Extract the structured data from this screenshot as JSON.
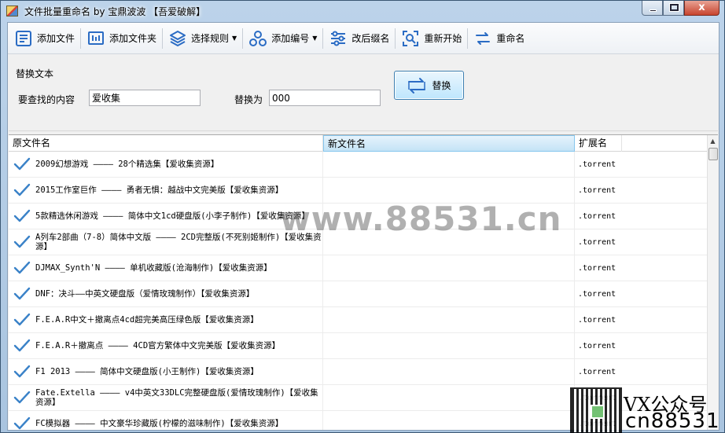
{
  "window": {
    "title": "文件批量重命名 by 宝鼎波波 【吾爱破解】",
    "close_glyph": "x"
  },
  "toolbar": {
    "add_file": "添加文件",
    "add_folder": "添加文件夹",
    "select_rule": "选择规则",
    "add_number": "添加编号",
    "change_ext": "改后缀名",
    "restart": "重新开始",
    "rename": "重命名"
  },
  "replace_panel": {
    "group_title": "替换文本",
    "find_label": "要查找的内容",
    "find_value": "爱收集",
    "replace_label": "替换为",
    "replace_value": "000",
    "replace_button": "替换"
  },
  "grid": {
    "columns": [
      "原文件名",
      "新文件名",
      "扩展名"
    ],
    "rows": [
      {
        "original": "2009幻想游戏 ———— 28个精选集【爱收集资源】",
        "new": "",
        "ext": ".torrent"
      },
      {
        "original": "2015工作室巨作 ———— 勇者无惧：越战中文完美版【爱收集资源】",
        "new": "",
        "ext": ".torrent"
      },
      {
        "original": "5款精选休闲游戏 ———— 简体中文1cd硬盘版(小李子制作)【爱收集资源】",
        "new": "",
        "ext": ".torrent"
      },
      {
        "original": "A列车2部曲（7-8）简体中文版 ———— 2CD完整版(不死别姬制作)【爱收集资源】",
        "new": "",
        "ext": ".torrent"
      },
      {
        "original": "DJMAX_Synth'N ———— 单机收藏版(沧海制作)【爱收集资源】",
        "new": "",
        "ext": ".torrent"
      },
      {
        "original": "DNF：决斗——中英文硬盘版（爱情玫瑰制作）【爱收集资源】",
        "new": "",
        "ext": ".torrent"
      },
      {
        "original": "F.E.A.R中文＋撤离点4cd超完美高压绿色版【爱收集资源】",
        "new": "",
        "ext": ".torrent"
      },
      {
        "original": "F.E.A.R＋撤离点 ———— 4CD官方繁体中文完美版【爱收集资源】",
        "new": "",
        "ext": ".torrent"
      },
      {
        "original": "F1 2013 ———— 简体中文硬盘版(小王制作)【爱收集资源】",
        "new": "",
        "ext": ".torrent"
      },
      {
        "original": "Fate.Extella ———— v4中英文33DLC完整硬盘版(爱情玫瑰制作)【爱收集资源】",
        "new": "",
        "ext": ".torrent"
      },
      {
        "original": "FC模拟器 ———— 中文豪华珍藏版(柠檬的滋味制作)【爱收集资源】",
        "new": "",
        "ext": ".torrent"
      }
    ]
  },
  "overlay": {
    "watermark": "www.88531.cn",
    "promo_line1": "VX公众号",
    "promo_line2": "cn88531"
  }
}
